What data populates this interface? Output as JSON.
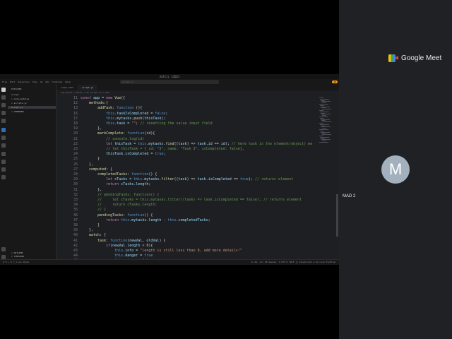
{
  "meet": {
    "brand": "Google Meet",
    "avatar_initial": "M",
    "participant_name": "MAD 2"
  },
  "editor": {
    "title": "Jaltiı 12021",
    "menu": [
      "File",
      "Edit",
      "Selection",
      "View",
      "Go",
      "Run",
      "Terminal",
      "Help"
    ],
    "search": "script.js",
    "ai_badge": "20",
    "explorer": {
      "header": "EXPLORER",
      "items": [
        "script",
        "> node_modules",
        "> scripts.js",
        "script.js",
        "> COMMANDS"
      ],
      "outline": [
        "> OUTLINE",
        "> TIMELINE"
      ]
    },
    "tabs": [
      "index.html",
      "script.js"
    ],
    "breadcrumb": "vue-watch > Mirai > JS script.js > Vue",
    "status": {
      "left": "⊗ 0 ⚠ 0   ⓘ Live Share",
      "right": "Ln 42, Col 18   Spaces: 4   UTF-8   CRLF   {} JavaScript   ⊕ Go Live   Prettier"
    }
  },
  "code_lines": [
    {
      "n": "11",
      "t": "const app = new Vue({"
    },
    {
      "n": "12",
      "t": "    methods:{"
    },
    {
      "n": "13",
      "t": "        addTask: function (){"
    },
    {
      "n": "16",
      "t": "            this.taskIsCompleted = false;"
    },
    {
      "n": "17",
      "t": "            this.mytasks.push(thisTask);"
    },
    {
      "n": "18",
      "t": "            this.task = \"\"; // resetting the value input field"
    },
    {
      "n": "19",
      "t": "        },"
    },
    {
      "n": "20",
      "t": "        markComplete: function(id){"
    },
    {
      "n": "21",
      "t": "            // console.log(id)"
    },
    {
      "n": "22",
      "t": "            let thisTask = this.mytasks.find((task) => task.id == id); // here task is the element(object) me"
    },
    {
      "n": "23",
      "t": "            // let thisTask = { id: \"3\", name: \"Task 3\", isCompleted: false},"
    },
    {
      "n": "24",
      "t": "            thisTask.isCompleted = true;"
    },
    {
      "n": "25",
      "t": "        }"
    },
    {
      "n": "26",
      "t": "    },"
    },
    {
      "n": "27",
      "t": "    computed: {"
    },
    {
      "n": "28",
      "t": "        completedTasks: function() {"
    },
    {
      "n": "29",
      "t": "            let cTasks = this.mytasks.filter((task) => task.isCompleted == true); // returns element"
    },
    {
      "n": "30",
      "t": "            return cTasks.length;"
    },
    {
      "n": "31",
      "t": "        },"
    },
    {
      "n": "32",
      "t": "        // pendingTasks: function() {"
    },
    {
      "n": "33",
      "t": "        //     let cTasks = this.mytasks.filter((task) => task.isCompleted == false); // returns element"
    },
    {
      "n": "34",
      "t": "        //     return cTasks.length;"
    },
    {
      "n": "35",
      "t": "        // }"
    },
    {
      "n": "36",
      "t": "        pendingTasks: function() {"
    },
    {
      "n": "37",
      "t": "            return this.mytasks.length - this.completedTasks;"
    },
    {
      "n": "38",
      "t": "        }"
    },
    {
      "n": "39",
      "t": "    },"
    },
    {
      "n": "40",
      "t": "    watch: {"
    },
    {
      "n": "41",
      "t": "        task: function(newVal, oldVal) {"
    },
    {
      "n": "42",
      "t": "            if(newVal.length < 8){"
    },
    {
      "n": "43",
      "t": "                this.info = \"length is still less than 8, add more details!\""
    },
    {
      "n": "44",
      "t": "                this.danger = true"
    },
    {
      "n": "45",
      "t": "                this.green = false"
    },
    {
      "n": "46",
      "t": "            }"
    }
  ],
  "colors": {
    "meet_bg": "#202124",
    "editor_bg": "#1e1f22",
    "accent": "#f59e0b"
  }
}
